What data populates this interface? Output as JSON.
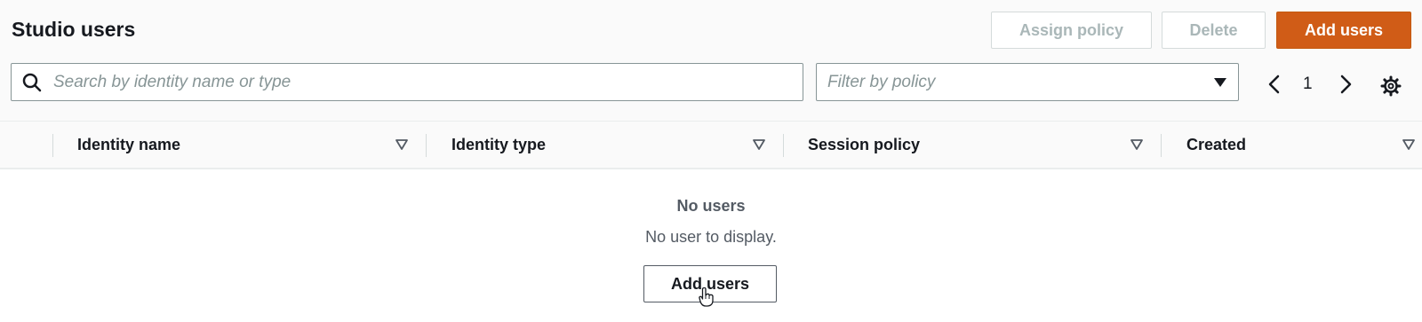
{
  "header": {
    "title": "Studio users",
    "assign_policy_label": "Assign policy",
    "delete_label": "Delete",
    "add_users_label": "Add users"
  },
  "search": {
    "placeholder": "Search by identity name or type"
  },
  "filter": {
    "placeholder": "Filter by policy"
  },
  "pagination": {
    "current_page": "1"
  },
  "table": {
    "columns": [
      {
        "label": "Identity name"
      },
      {
        "label": "Identity type"
      },
      {
        "label": "Session policy"
      },
      {
        "label": "Created"
      }
    ],
    "empty": {
      "title": "No users",
      "message": "No user to display.",
      "button_label": "Add users"
    }
  },
  "colors": {
    "primary_button": "#d05c17",
    "text": "#16191f",
    "muted_text": "#545b64",
    "placeholder": "#879596",
    "disabled_text": "#aab7b8"
  },
  "icons": [
    "search-icon",
    "caret-down-icon",
    "chevron-left-icon",
    "chevron-right-icon",
    "gear-icon",
    "sort-icon",
    "hand-pointer-icon"
  ]
}
